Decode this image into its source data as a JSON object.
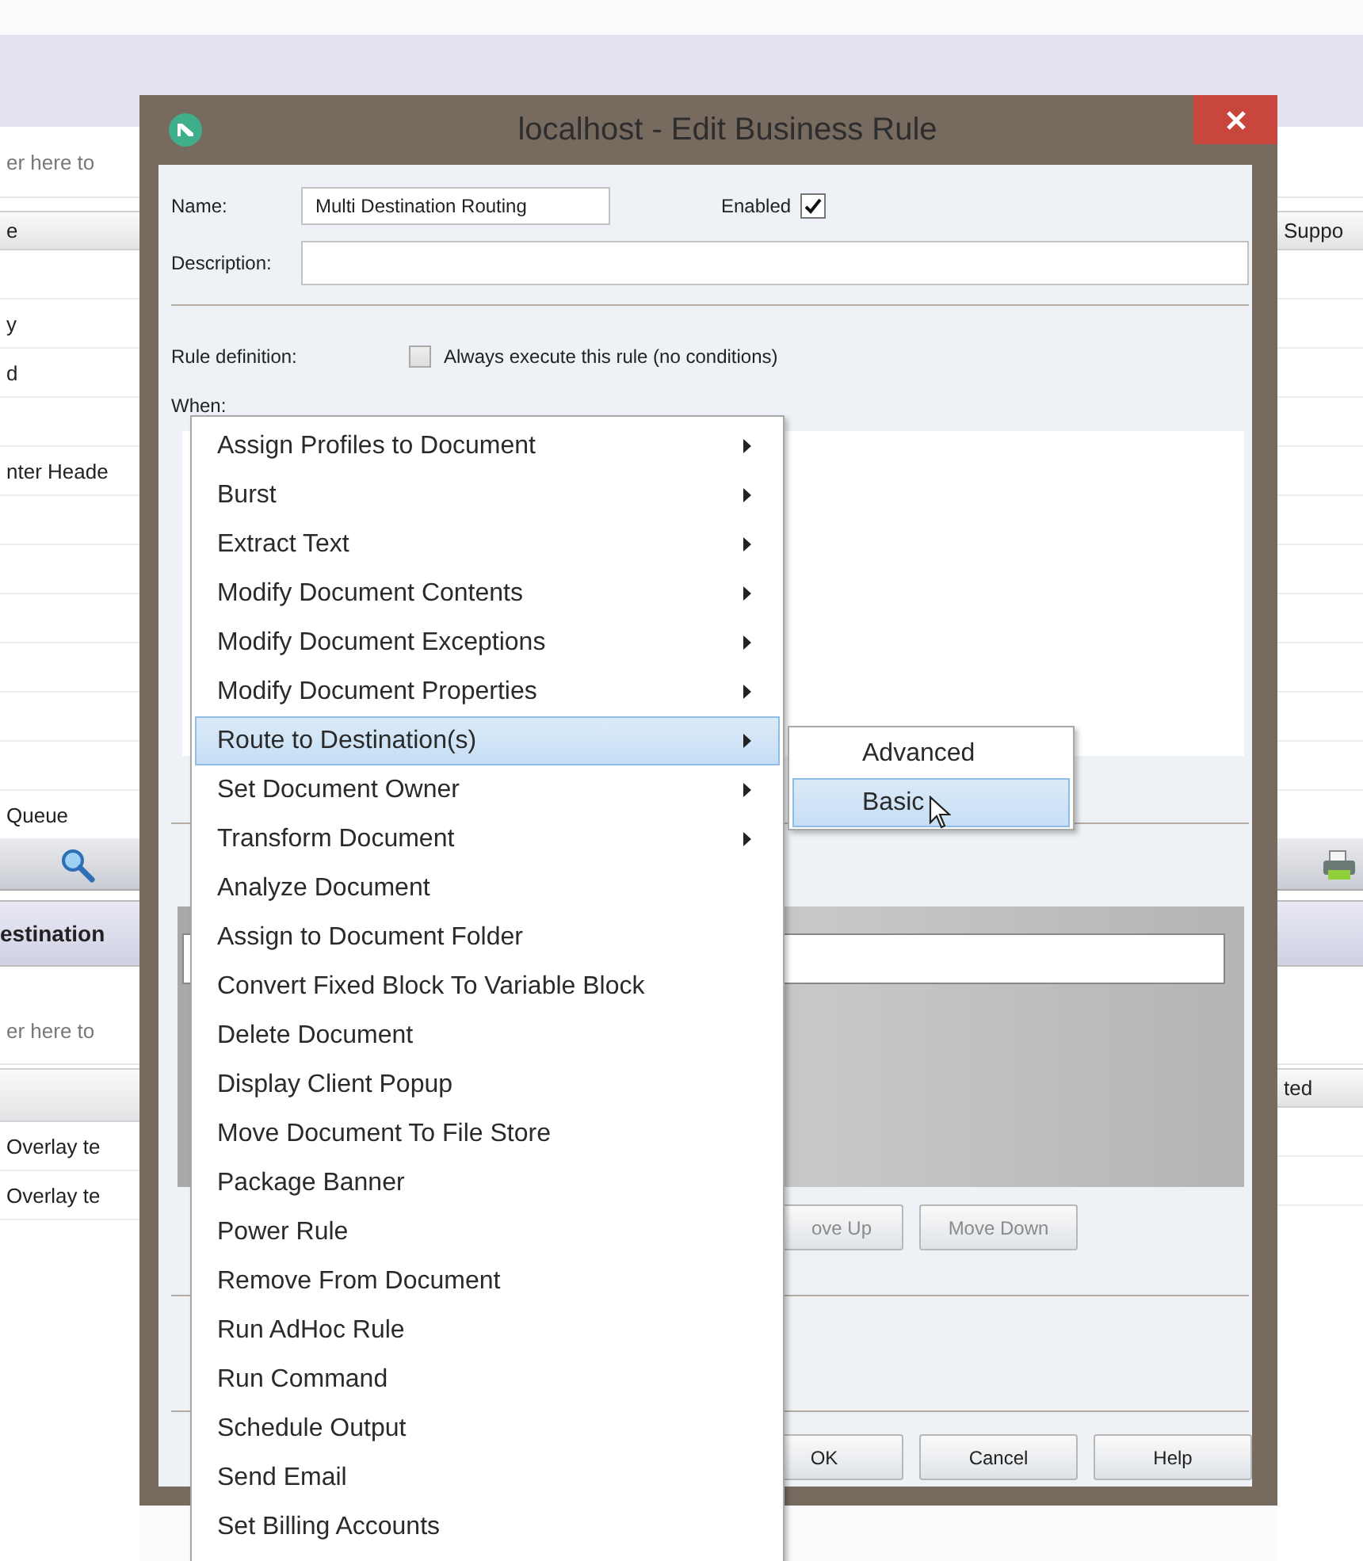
{
  "background_app": {
    "left": {
      "filter_placeholder": "er here to",
      "column_header": "e",
      "rows": [
        "y",
        "d",
        "nter Heade",
        "Queue"
      ],
      "section_title": "estination",
      "filter_placeholder_2": "er here to",
      "rows_2": [
        "Overlay te",
        "Overlay te"
      ]
    },
    "right": {
      "column_header": "Suppo",
      "column_header_2": "ted"
    }
  },
  "dialog": {
    "title": "localhost - Edit Business Rule",
    "name": {
      "label": "Name:",
      "value": "Multi Destination Routing"
    },
    "enabled": {
      "label": "Enabled",
      "checked": true
    },
    "description": {
      "label": "Description:"
    },
    "rule_definition": {
      "label": "Rule definition:"
    },
    "always_execute": {
      "label": "Always execute this rule (no conditions)",
      "checked": false
    },
    "when_label": "When:",
    "buttons": [
      {
        "label": "ove Up",
        "kind": "move"
      },
      {
        "label": "Move Down",
        "kind": "move"
      },
      {
        "label": "OK",
        "kind": "footer"
      },
      {
        "label": "Cancel",
        "kind": "footer"
      },
      {
        "label": "Help",
        "kind": "footer"
      }
    ]
  },
  "context_menu": {
    "items": [
      {
        "label": "Assign Profiles to Document",
        "submenu": true,
        "selected": false
      },
      {
        "label": "Burst",
        "submenu": true,
        "selected": false
      },
      {
        "label": "Extract Text",
        "submenu": true,
        "selected": false
      },
      {
        "label": "Modify Document Contents",
        "submenu": true,
        "selected": false
      },
      {
        "label": "Modify Document Exceptions",
        "submenu": true,
        "selected": false
      },
      {
        "label": "Modify Document Properties",
        "submenu": true,
        "selected": false
      },
      {
        "label": "Route to Destination(s)",
        "submenu": true,
        "selected": true
      },
      {
        "label": "Set Document Owner",
        "submenu": true,
        "selected": false
      },
      {
        "label": "Transform Document",
        "submenu": true,
        "selected": false
      },
      {
        "label": "Analyze Document",
        "submenu": false,
        "selected": false
      },
      {
        "label": "Assign to Document Folder",
        "submenu": false,
        "selected": false
      },
      {
        "label": "Convert Fixed Block To Variable Block",
        "submenu": false,
        "selected": false
      },
      {
        "label": "Delete Document",
        "submenu": false,
        "selected": false
      },
      {
        "label": "Display Client Popup",
        "submenu": false,
        "selected": false
      },
      {
        "label": "Move Document To File Store",
        "submenu": false,
        "selected": false
      },
      {
        "label": "Package Banner",
        "submenu": false,
        "selected": false
      },
      {
        "label": "Power Rule",
        "submenu": false,
        "selected": false
      },
      {
        "label": "Remove From Document",
        "submenu": false,
        "selected": false
      },
      {
        "label": "Run AdHoc Rule",
        "submenu": false,
        "selected": false
      },
      {
        "label": "Run Command",
        "submenu": false,
        "selected": false
      },
      {
        "label": "Schedule Output",
        "submenu": false,
        "selected": false
      },
      {
        "label": "Send Email",
        "submenu": false,
        "selected": false
      },
      {
        "label": "Set Billing Accounts",
        "submenu": false,
        "selected": false
      }
    ],
    "submenu": [
      {
        "label": "Advanced",
        "selected": false
      },
      {
        "label": "Basic",
        "selected": true
      }
    ]
  }
}
